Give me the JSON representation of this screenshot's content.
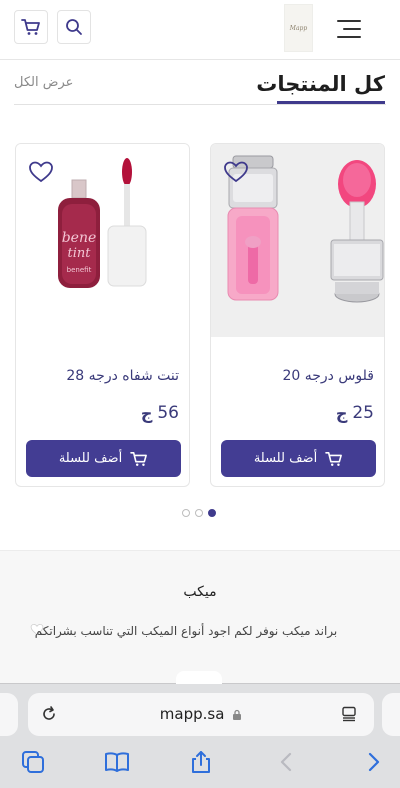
{
  "header": {
    "logo_text": "Mapp",
    "icons": {
      "cart": "cart-icon",
      "search": "search-icon",
      "menu": "menu-icon"
    }
  },
  "section": {
    "title": "كل المنتجات",
    "view_all": "عرض الكل"
  },
  "products": [
    {
      "name": "قلوس درجه 20",
      "price": "25",
      "currency": "ج",
      "add_to_cart": "أضف للسلة"
    },
    {
      "name": "تنت شفاه درجه 28",
      "price": "56",
      "currency": "ج",
      "add_to_cart": "أضف للسلة"
    }
  ],
  "pager": {
    "count": 3,
    "active": 0
  },
  "brand": {
    "title": "ميكب",
    "description": "براند ميكب نوفر لكم اجود أنواع الميكب التي تناسب بشراتكم"
  },
  "browser": {
    "url": "mapp.sa"
  },
  "colors": {
    "accent": "#433d93",
    "text_primary": "#3a3a7a",
    "browser_bar": "#dfe0e2",
    "toolbar_icon": "#2f6fdb"
  }
}
